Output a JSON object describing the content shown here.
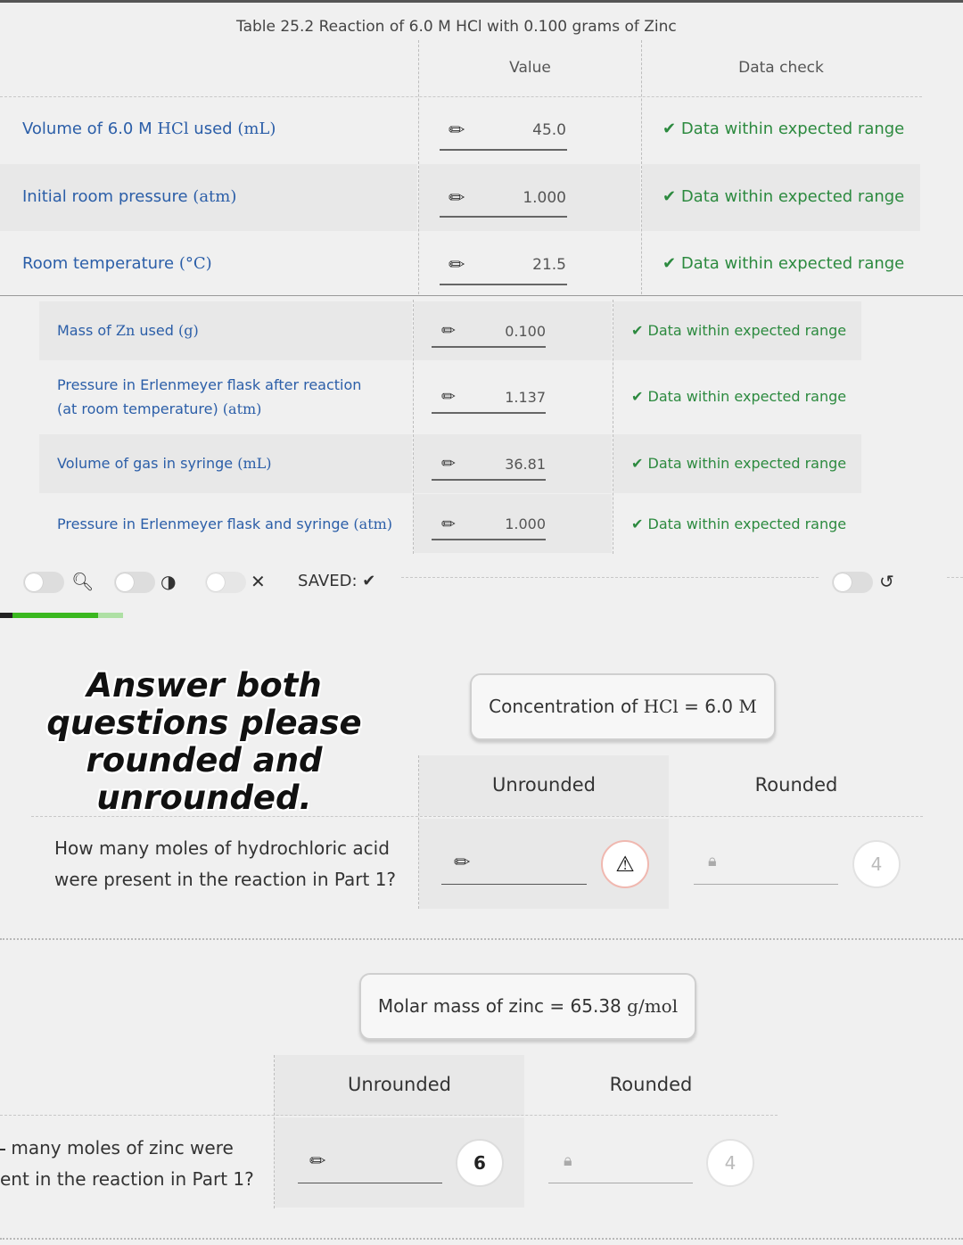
{
  "table1": {
    "caption": "Table 25.2 Reaction of 6.0 M HCl with 0.100 grams of Zinc",
    "col_value": "Value",
    "col_check": "Data check",
    "rows": [
      {
        "label_pre": "Volume of 6.0 M ",
        "label_math": "HCl",
        "label_post": " used ",
        "unit": "(mL)",
        "value": "45.0",
        "check": "Data within expected range"
      },
      {
        "label_pre": "Initial room pressure ",
        "label_math": "",
        "label_post": "",
        "unit": "(atm)",
        "value": "1.000",
        "check": "Data within expected range"
      },
      {
        "label_pre": "Room temperature ",
        "label_math": "",
        "label_post": "",
        "unit": "(°C)",
        "value": "21.5",
        "check": "Data within expected range"
      }
    ]
  },
  "table2": {
    "rows": [
      {
        "label_pre": "Mass of ",
        "label_math": "Zn",
        "label_post": " used ",
        "unit": "(g)",
        "label_line2": "",
        "value": "0.100",
        "check": "Data within expected range"
      },
      {
        "label_pre": "Pressure in Erlenmeyer flask after reaction",
        "label_math": "",
        "label_post": "",
        "unit": "",
        "label_line2": "(at room temperature) ",
        "unit2": "(atm)",
        "value": "1.137",
        "check": "Data within expected range"
      },
      {
        "label_pre": "Volume of gas in syringe ",
        "label_math": "",
        "label_post": "",
        "unit": "(mL)",
        "label_line2": "",
        "value": "36.81",
        "check": "Data within expected range"
      },
      {
        "label_pre": "Pressure in Erlenmeyer flask and syringe ",
        "label_math": "",
        "label_post": "",
        "unit": "(atm)",
        "label_line2": "",
        "value": "1.000",
        "check": "Data within expected range"
      }
    ]
  },
  "toolbar": {
    "saved_label": "SAVED:"
  },
  "progress": {
    "fraction": 0.8
  },
  "overlay": {
    "text": "Answer both questions please rounded and unrounded."
  },
  "q1": {
    "info_pre": "Concentration of ",
    "info_math": "HCl",
    "info_post": " = 6.0 ",
    "info_unit": "M",
    "col_unrounded": "Unrounded",
    "col_rounded": "Rounded",
    "question_line1": "How many moles of hydrochloric acid",
    "question_line2": "were present in the reaction in Part 1?",
    "unrounded_value": "",
    "rounded_value": "",
    "rounded_sigfigs": "4"
  },
  "q2": {
    "info_pre": "Molar mass of zinc = 65.38 ",
    "info_unit": "g/mol",
    "col_unrounded": "Unrounded",
    "col_rounded": "Rounded",
    "question_line1": "many moles of zinc were",
    "question_line2": "ent in the reaction in Part 1?",
    "unrounded_sigfigs": "6",
    "rounded_sigfigs": "4"
  }
}
